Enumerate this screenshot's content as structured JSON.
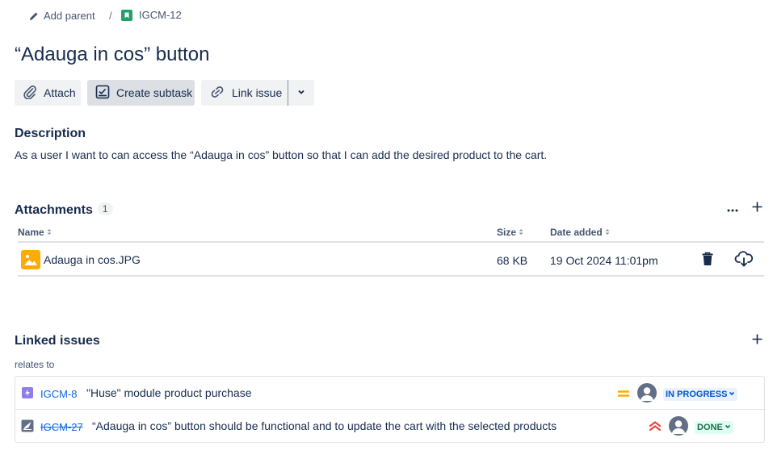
{
  "breadcrumb": {
    "add_parent_label": "Add parent",
    "separator": "/",
    "issue_key": "IGCM-12"
  },
  "issue": {
    "title": "“Adauga in cos” button"
  },
  "toolbar": {
    "attach_label": "Attach",
    "create_subtask_label": "Create subtask",
    "link_issue_label": "Link issue"
  },
  "description": {
    "heading": "Description",
    "text": "As a user I want to can access the “Adauga in cos” button so that I can add the desired product to the cart."
  },
  "attachments": {
    "heading": "Attachments",
    "count": "1",
    "columns": {
      "name": "Name",
      "size": "Size",
      "date_added": "Date added"
    },
    "rows": [
      {
        "name": "Adauga in cos.JPG",
        "size": "68 KB",
        "date_added": "19 Oct 2024 11:01pm"
      }
    ]
  },
  "linked_issues": {
    "heading": "Linked issues",
    "relation": "relates to",
    "items": [
      {
        "key": "IGCM-8",
        "summary": "\"Huse\" module product purchase",
        "status": "IN PROGRESS",
        "priority": "medium",
        "type": "epic",
        "resolved": false
      },
      {
        "key": "IGCM-27",
        "summary": "“Adauga in cos” button should be functional and to update the cart with the selected products",
        "status": "DONE",
        "priority": "highest",
        "type": "feature",
        "resolved": true
      }
    ]
  },
  "colors": {
    "text": "#172b4d",
    "link": "#0c66e4",
    "status_in_progress_bg": "#e9f2ff",
    "status_in_progress_text": "#0055cc",
    "status_done_bg": "#dcfff1",
    "status_done_text": "#216e4e",
    "priority_medium": "#ffab00",
    "priority_highest": "#e2483d",
    "epic": "#8f7ee7",
    "story": "#22a06b"
  }
}
